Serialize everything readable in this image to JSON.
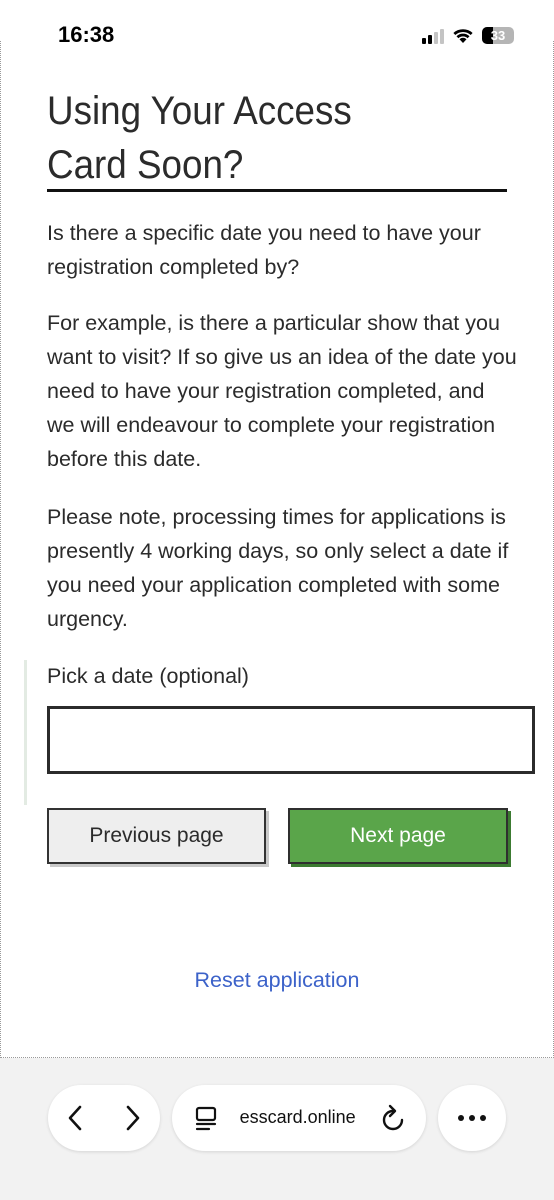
{
  "status_bar": {
    "time": "16:38",
    "battery": "33",
    "battery_level": 0.33
  },
  "page": {
    "title": "Using Your Access Card Soon?",
    "paragraphs": [
      "Is there a specific date you need to have your registration completed by?",
      "For example, is there a particular show that you want to visit? If so give us an idea of the date you need to have your registration completed, and we will endeavour to complete your registration before this date.",
      "Please note, processing times for applications is presently 4 working days, so only select a date if you need your application completed with some urgency."
    ],
    "date_field": {
      "label": "Pick a date (optional)",
      "value": "",
      "placeholder": ""
    },
    "buttons": {
      "previous": "Previous page",
      "next": "Next page"
    },
    "reset_link": "Reset application"
  },
  "browser": {
    "url": " esscard.online",
    "icons": [
      "back-icon",
      "forward-icon",
      "tabs-icon",
      "reload-icon",
      "more-icon"
    ]
  },
  "colors": {
    "next_button": "#5aa54a",
    "link": "#3c62c9",
    "text": "#2b2b2b"
  }
}
